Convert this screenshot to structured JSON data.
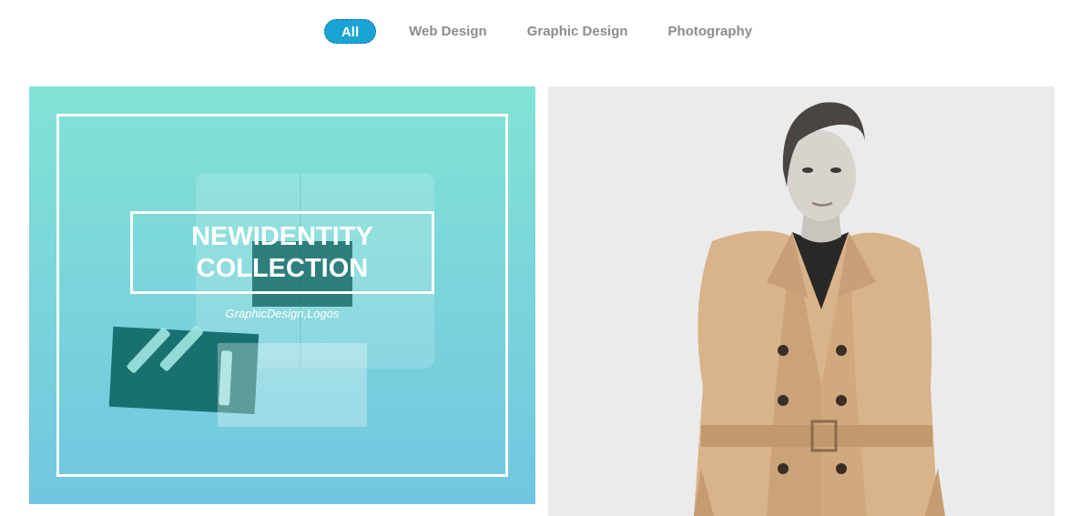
{
  "filters": [
    {
      "label": "All",
      "active": true
    },
    {
      "label": "Web Design",
      "active": false
    },
    {
      "label": "Graphic Design",
      "active": false
    },
    {
      "label": "Photography",
      "active": false
    }
  ],
  "portfolio": {
    "items": [
      {
        "title_line1": "NEWIDENTITY",
        "title_line2": "COLLECTION",
        "tags": "GraphicDesign,Logos",
        "overlay_colors": [
          "#82e3d6",
          "#70c6e0"
        ]
      },
      {
        "image": "woman-in-trench-coat",
        "background": "#ebebeb"
      }
    ]
  },
  "colors": {
    "accent": "#1aa4d6",
    "filter_text": "#8c8c8c"
  }
}
